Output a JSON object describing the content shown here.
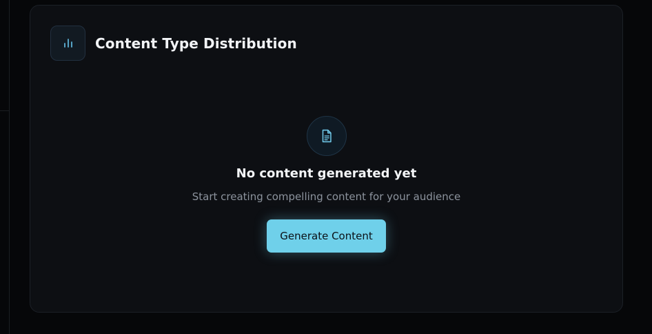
{
  "card": {
    "title": "Content Type Distribution",
    "title_icon": "bar-chart-icon"
  },
  "empty_state": {
    "icon": "document-icon",
    "title": "No content generated yet",
    "subtitle": "Start creating compelling content for your audience",
    "button_label": "Generate Content"
  },
  "colors": {
    "background": "#060709",
    "card": "#0d0f13",
    "accent": "#6fd0ea",
    "icon_accent": "#5fb3d8",
    "muted_text": "#8c939d"
  }
}
